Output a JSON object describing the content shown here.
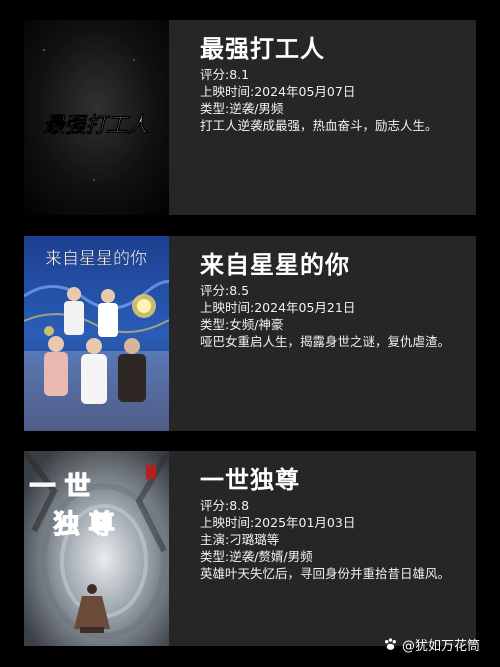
{
  "items": [
    {
      "title": "最强打工人",
      "rating": "评分:8.1",
      "release": "上映时间:2024年05月07日",
      "genre": "类型:逆袭/男频",
      "description": "打工人逆袭成最强，热血奋斗，励志人生。",
      "poster_text": "最强打工人"
    },
    {
      "title": "来自星星的你",
      "rating": "评分:8.5",
      "release": "上映时间:2024年05月21日",
      "genre": "类型:女频/神豪",
      "description": "哑巴女重启人生，揭露身世之谜，复仇虐渣。",
      "poster_text": "来自星星的你"
    },
    {
      "title": "一世独尊",
      "rating": "评分:8.8",
      "release": "上映时间:2025年01月03日",
      "cast": "主演:刁璐璐等",
      "genre": "类型:逆袭/赘婿/男频",
      "description": "英雄叶天失忆后，寻回身份并重拾昔日雄风。",
      "poster_line1": "一 世",
      "poster_line2": "独 尊"
    }
  ],
  "watermark": {
    "text": "@犹如万花筒",
    "icon": "paw-icon"
  },
  "colors": {
    "background": "#000000",
    "card": "#262626",
    "text": "#ffffff"
  }
}
